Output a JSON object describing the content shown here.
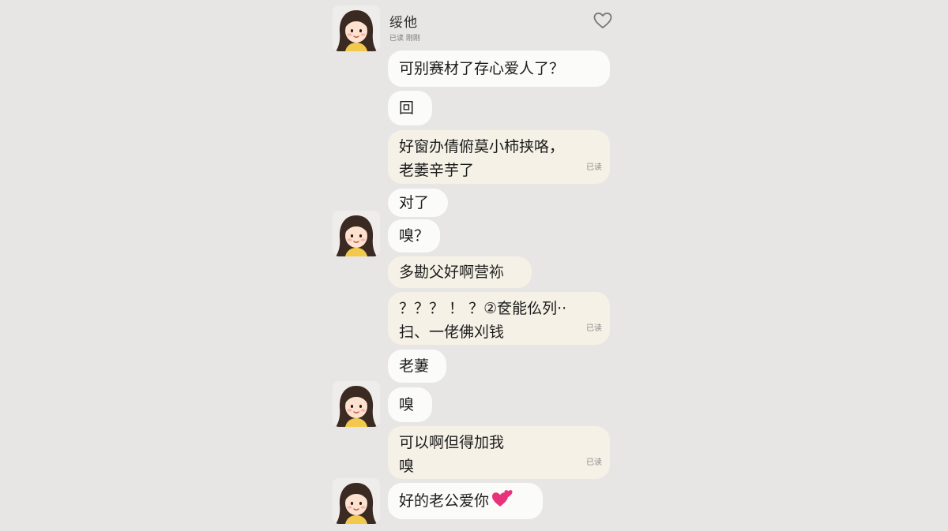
{
  "header": {
    "contact_name": "绥他",
    "contact_status": "已读 刚刚"
  },
  "messages": [
    {
      "text": "可别赛材了存心爱人了？"
    },
    {
      "text": "回"
    },
    {
      "lines": [
        "好窗办倩俯莫小柿挟咯，",
        "老萎辛芋了"
      ],
      "meta": "已读"
    },
    {
      "text": "对了"
    },
    {
      "text": "嗅？"
    },
    {
      "text": "多勘父好啊营袮"
    },
    {
      "lines": [
        "？？？ ！ ？②奁能仫列··",
        "扫、一佬佛刈钱"
      ],
      "meta": "已读"
    },
    {
      "text": "老萋"
    },
    {
      "text": "嗅"
    },
    {
      "lines": [
        "可以啊但得加我",
        "嗅"
      ],
      "meta": "已读"
    },
    {
      "text": "好的老公爱你",
      "emoji": "💕"
    }
  ],
  "colors": {
    "background": "#e8e6e5",
    "bubble_white": "#fbfbfa",
    "bubble_cream": "#f6f1e6",
    "emoji_heart": "#e8337a"
  },
  "icons": {
    "header_action": "heart-outline-icon",
    "avatar": "girl-avatar-icon"
  }
}
